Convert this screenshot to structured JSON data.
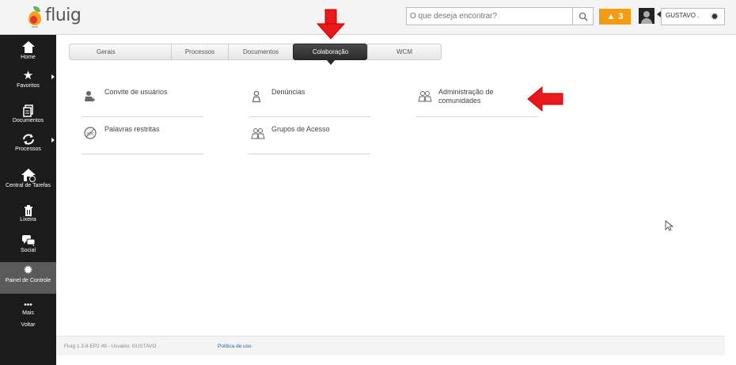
{
  "header": {
    "logo_text": "fluig",
    "search_placeholder": "O que deseja encontrar?",
    "alert_count": "3",
    "user_name": "GUSTAVO ."
  },
  "sidebar": {
    "items": [
      {
        "label": "Home",
        "icon": "home-icon"
      },
      {
        "label": "Favoritos",
        "icon": "star-icon"
      },
      {
        "label": "Documentos",
        "icon": "documents-icon"
      },
      {
        "label": "Processos",
        "icon": "processes-icon"
      },
      {
        "label": "Central de Tarefas",
        "icon": "task-center-icon"
      },
      {
        "label": "Lixeira",
        "icon": "trash-icon"
      },
      {
        "label": "Social",
        "icon": "social-icon"
      },
      {
        "label": "Painel de Controle",
        "icon": "gear-icon"
      },
      {
        "label": "Mais",
        "icon": "more-icon"
      },
      {
        "label": "Voltar"
      }
    ]
  },
  "tabs": {
    "gerais": "Gerais",
    "processos": "Processos",
    "documentos": "Documentos",
    "colaboracao": "Colaboração",
    "wcm": "WCM"
  },
  "tiles": {
    "convite": "Convite de usuários",
    "denuncias": "Denúncias",
    "admin_line1": "Administração de",
    "admin_line2": "comunidades",
    "palavras": "Palavras restritas",
    "grupos": "Grupos de Acesso"
  },
  "footer": {
    "version_text": "Fluig 1.3.8-EP2 49 - Usuário: GUSTAVO .",
    "privacy_link": "Política de uso"
  },
  "colors": {
    "sidebar_bg": "#1b1b1b",
    "alert": "#f39c12",
    "annotation_arrow": "#e8191c"
  }
}
